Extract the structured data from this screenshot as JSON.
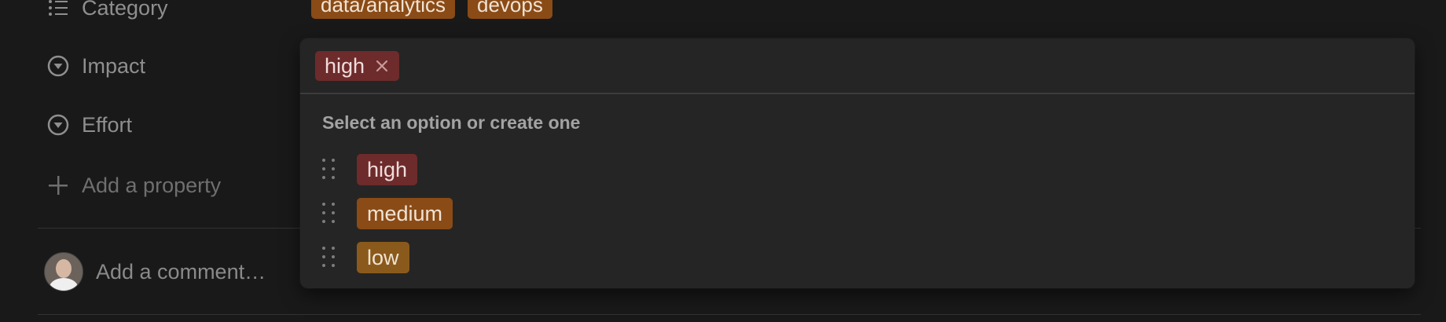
{
  "properties": {
    "category": {
      "label": "Category",
      "tags": [
        "data/analytics",
        "devops"
      ]
    },
    "impact": {
      "label": "Impact"
    },
    "effort": {
      "label": "Effort"
    },
    "add_property": {
      "label": "Add a property"
    }
  },
  "comment": {
    "placeholder": "Add a comment…"
  },
  "popup": {
    "selected": "high",
    "hint": "Select an option or create one",
    "options": [
      {
        "label": "high",
        "color": "#6e2b2b"
      },
      {
        "label": "medium",
        "color": "#8a4b17"
      },
      {
        "label": "low",
        "color": "#8a5a1c"
      }
    ]
  }
}
